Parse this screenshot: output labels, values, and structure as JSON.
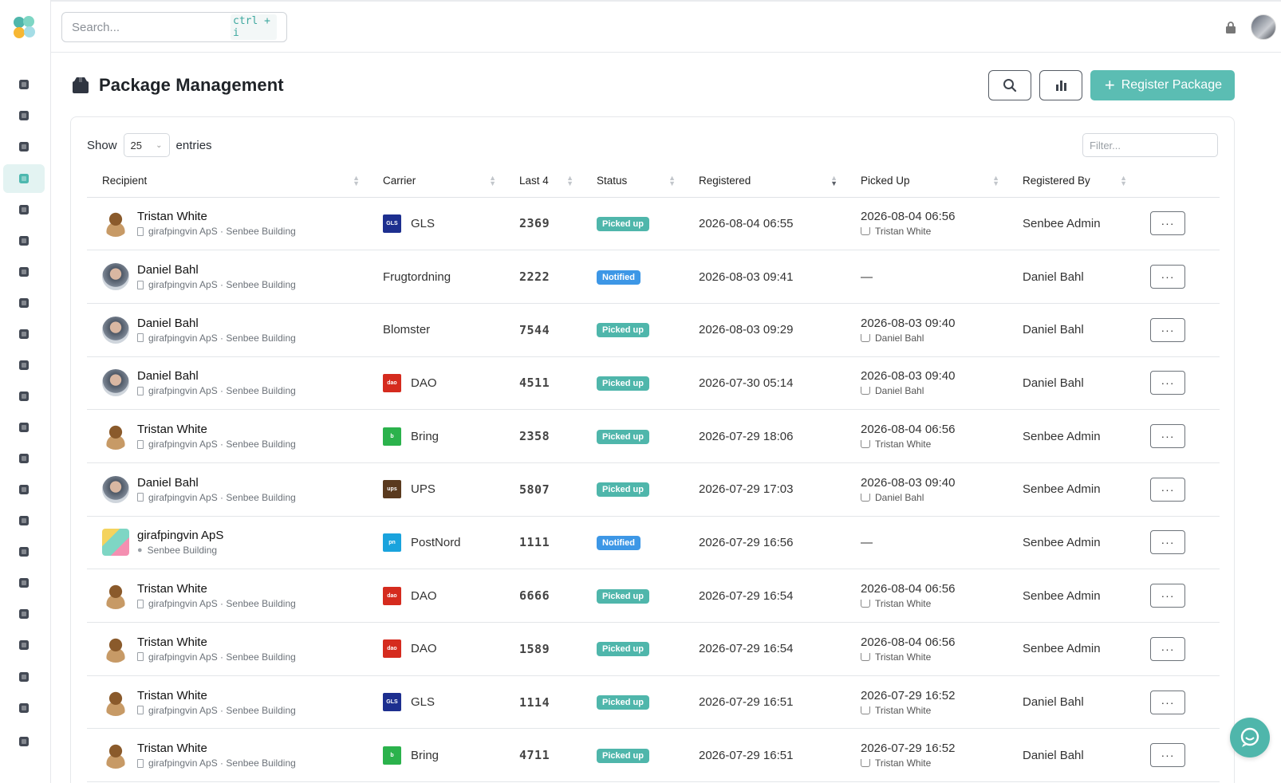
{
  "search": {
    "placeholder": "Search...",
    "shortcut": "ctrl + i"
  },
  "page": {
    "title": "Package Management",
    "register_label": "Register Package"
  },
  "table_controls": {
    "show_label": "Show",
    "entries_value": "25",
    "entries_label": "entries",
    "filter_placeholder": "Filter..."
  },
  "columns": [
    "Recipient",
    "Carrier",
    "Last 4",
    "Status",
    "Registered",
    "Picked Up",
    "Registered By"
  ],
  "rows": [
    {
      "name": "Tristan White",
      "sub": "girafpingvin ApS · Senbee Building",
      "avatar": "robot",
      "carrier": "GLS",
      "carrier_logo": "gls",
      "last4": "2369",
      "status": "Picked up",
      "registered": "2026-08-04 06:55",
      "picked_up": "2026-08-04 06:56",
      "picked_by": "Tristan White",
      "registered_by": "Senbee Admin"
    },
    {
      "name": "Daniel Bahl",
      "sub": "girafpingvin ApS · Senbee Building",
      "avatar": "person",
      "carrier": "Frugtordning",
      "carrier_logo": "",
      "last4": "2222",
      "status": "Notified",
      "registered": "2026-08-03 09:41",
      "picked_up": "—",
      "picked_by": "",
      "registered_by": "Daniel Bahl"
    },
    {
      "name": "Daniel Bahl",
      "sub": "girafpingvin ApS · Senbee Building",
      "avatar": "person",
      "carrier": "Blomster",
      "carrier_logo": "",
      "last4": "7544",
      "status": "Picked up",
      "registered": "2026-08-03 09:29",
      "picked_up": "2026-08-03 09:40",
      "picked_by": "Daniel Bahl",
      "registered_by": "Daniel Bahl"
    },
    {
      "name": "Daniel Bahl",
      "sub": "girafpingvin ApS · Senbee Building",
      "avatar": "person",
      "carrier": "DAO",
      "carrier_logo": "dao",
      "last4": "4511",
      "status": "Picked up",
      "registered": "2026-07-30 05:14",
      "picked_up": "2026-08-03 09:40",
      "picked_by": "Daniel Bahl",
      "registered_by": "Daniel Bahl"
    },
    {
      "name": "Tristan White",
      "sub": "girafpingvin ApS · Senbee Building",
      "avatar": "robot",
      "carrier": "Bring",
      "carrier_logo": "bring",
      "last4": "2358",
      "status": "Picked up",
      "registered": "2026-07-29 18:06",
      "picked_up": "2026-08-04 06:56",
      "picked_by": "Tristan White",
      "registered_by": "Senbee Admin"
    },
    {
      "name": "Daniel Bahl",
      "sub": "girafpingvin ApS · Senbee Building",
      "avatar": "person",
      "carrier": "UPS",
      "carrier_logo": "ups",
      "last4": "5807",
      "status": "Picked up",
      "registered": "2026-07-29 17:03",
      "picked_up": "2026-08-03 09:40",
      "picked_by": "Daniel Bahl",
      "registered_by": "Senbee Admin"
    },
    {
      "name": "girafpingvin ApS",
      "sub": "Senbee Building",
      "avatar": "org",
      "carrier": "PostNord",
      "carrier_logo": "postnord",
      "last4": "1111",
      "status": "Notified",
      "registered": "2026-07-29 16:56",
      "picked_up": "—",
      "picked_by": "",
      "registered_by": "Senbee Admin"
    },
    {
      "name": "Tristan White",
      "sub": "girafpingvin ApS · Senbee Building",
      "avatar": "robot",
      "carrier": "DAO",
      "carrier_logo": "dao",
      "last4": "6666",
      "status": "Picked up",
      "registered": "2026-07-29 16:54",
      "picked_up": "2026-08-04 06:56",
      "picked_by": "Tristan White",
      "registered_by": "Senbee Admin"
    },
    {
      "name": "Tristan White",
      "sub": "girafpingvin ApS · Senbee Building",
      "avatar": "robot",
      "carrier": "DAO",
      "carrier_logo": "dao",
      "last4": "1589",
      "status": "Picked up",
      "registered": "2026-07-29 16:54",
      "picked_up": "2026-08-04 06:56",
      "picked_by": "Tristan White",
      "registered_by": "Senbee Admin"
    },
    {
      "name": "Tristan White",
      "sub": "girafpingvin ApS · Senbee Building",
      "avatar": "robot",
      "carrier": "GLS",
      "carrier_logo": "gls",
      "last4": "1114",
      "status": "Picked up",
      "registered": "2026-07-29 16:51",
      "picked_up": "2026-07-29 16:52",
      "picked_by": "Tristan White",
      "registered_by": "Daniel Bahl"
    },
    {
      "name": "Tristan White",
      "sub": "girafpingvin ApS · Senbee Building",
      "avatar": "robot",
      "carrier": "Bring",
      "carrier_logo": "bring",
      "last4": "4711",
      "status": "Picked up",
      "registered": "2026-07-29 16:51",
      "picked_up": "2026-07-29 16:52",
      "picked_by": "Tristan White",
      "registered_by": "Daniel Bahl"
    }
  ],
  "row_actions_label": "···",
  "sidebar_icons": [
    "helicopter-icon",
    "users-icon",
    "people-arrows-icon",
    "box-icon",
    "robot-icon",
    "building-icon",
    "city-icon",
    "people-group-icon",
    "user-clock-icon",
    "truck-icon",
    "calendar-icon",
    "grid-icon",
    "escalator-icon",
    "building-small-icon",
    "desk-icon",
    "map-pin-icon",
    "globe-icon",
    "layers-icon",
    "apps-icon",
    "boxes-icon",
    "list-icon",
    "user-gear-icon"
  ],
  "colors": {
    "accent": "#5bbdb3",
    "picked_badge": "#4fb6ab",
    "notified_badge": "#3d97e6",
    "active_nav_bg": "#e3f3f2"
  }
}
